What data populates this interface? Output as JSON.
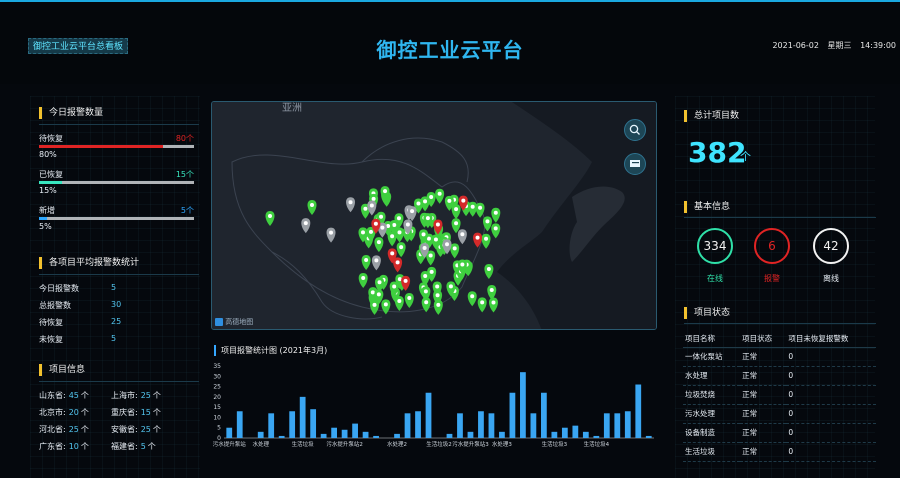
{
  "header": {
    "badge": "御控工业云平台总看板",
    "title": "御控工业云平台",
    "date": "2021-06-02",
    "weekday": "星期三",
    "time": "14:39:00"
  },
  "today_alarms": {
    "title": "今日报警数量",
    "rows": [
      {
        "label": "待恢复",
        "count": "80个",
        "percent_text": "80%",
        "percent": 0.8,
        "color": "#e02424"
      },
      {
        "label": "已恢复",
        "count": "15个",
        "percent_text": "15%",
        "percent": 0.15,
        "color": "#38e6c0"
      },
      {
        "label": "新增",
        "count": "5个",
        "percent_text": "5%",
        "percent": 0.05,
        "color": "#2fa8ff"
      }
    ]
  },
  "avg_alarm_stats": {
    "title": "各项目平均报警数统计",
    "items": [
      {
        "k": "今日报警数",
        "v": "5"
      },
      {
        "k": "总报警数",
        "v": "30"
      },
      {
        "k": "待恢复",
        "v": "25"
      },
      {
        "k": "未恢复",
        "v": "5"
      }
    ]
  },
  "project_info": {
    "title": "项目信息",
    "provinces": [
      {
        "name": "山东省:",
        "count": "45",
        "unit": "个"
      },
      {
        "name": "上海市:",
        "count": "25",
        "unit": "个"
      },
      {
        "name": "北京市:",
        "count": "20",
        "unit": "个"
      },
      {
        "name": "重庆省:",
        "count": "15",
        "unit": "个"
      },
      {
        "name": "河北省:",
        "count": "25",
        "unit": "个"
      },
      {
        "name": "安徽省:",
        "count": "25",
        "unit": "个"
      },
      {
        "name": "广东省:",
        "count": "10",
        "unit": "个"
      },
      {
        "name": "福建省:",
        "count": "5",
        "unit": "个"
      }
    ]
  },
  "map": {
    "region_label": "亚洲",
    "watermark": "高德地图",
    "search_icon": "search-icon",
    "layers_icon": "layers-icon",
    "markers": {
      "green": 90,
      "gray": 12,
      "red": 7
    }
  },
  "chart_title": "项目报警统计图 (2021年3月)",
  "chart_data": {
    "type": "bar",
    "ylim": [
      0,
      35
    ],
    "yticks": [
      0,
      5,
      10,
      15,
      20,
      25,
      30,
      35
    ],
    "categories": [
      "污水提升泵站",
      "",
      "",
      "水处理",
      "",
      "",
      "",
      "生活垃圾",
      "",
      "",
      "",
      "污水提升泵站2",
      "",
      "",
      "",
      "",
      "水处理2",
      "",
      "",
      "",
      "生活垃圾2",
      "",
      "",
      "污水提升泵站3",
      "",
      "",
      "水处理3",
      "",
      "",
      "",
      "",
      "生活垃圾3",
      "",
      "",
      "",
      "生活垃圾4",
      "",
      ""
    ],
    "values": [
      5,
      13,
      0,
      3,
      12,
      1,
      13,
      20,
      14,
      2,
      5,
      4,
      7,
      3,
      1,
      0,
      2,
      12,
      13,
      22,
      0,
      2,
      12,
      3,
      13,
      12,
      3,
      22,
      32,
      12,
      22,
      3,
      5,
      6,
      3,
      1,
      12,
      12,
      13,
      26,
      1
    ],
    "xlabel": "",
    "ylabel": "",
    "color": "#3aa6f2"
  },
  "total_projects": {
    "title": "总计项目数",
    "value": "382",
    "unit": "个"
  },
  "basic_info": {
    "title": "基本信息",
    "rings": [
      {
        "value": "334",
        "label": "在线",
        "color": "#2fe0a8"
      },
      {
        "value": "6",
        "label": "报警",
        "color": "#e02424"
      },
      {
        "value": "42",
        "label": "离线",
        "color": "#f2f2f2"
      }
    ]
  },
  "project_status": {
    "title": "项目状态",
    "columns": [
      "项目名称",
      "项目状态",
      "项目未恢复报警数"
    ],
    "rows": [
      [
        "一体化泵站",
        "正常",
        "0"
      ],
      [
        "水处理",
        "正常",
        "0"
      ],
      [
        "垃圾焚烧",
        "正常",
        "0"
      ],
      [
        "污水处理",
        "正常",
        "0"
      ],
      [
        "设备制造",
        "正常",
        "0"
      ],
      [
        "生活垃圾",
        "正常",
        "0"
      ]
    ]
  }
}
